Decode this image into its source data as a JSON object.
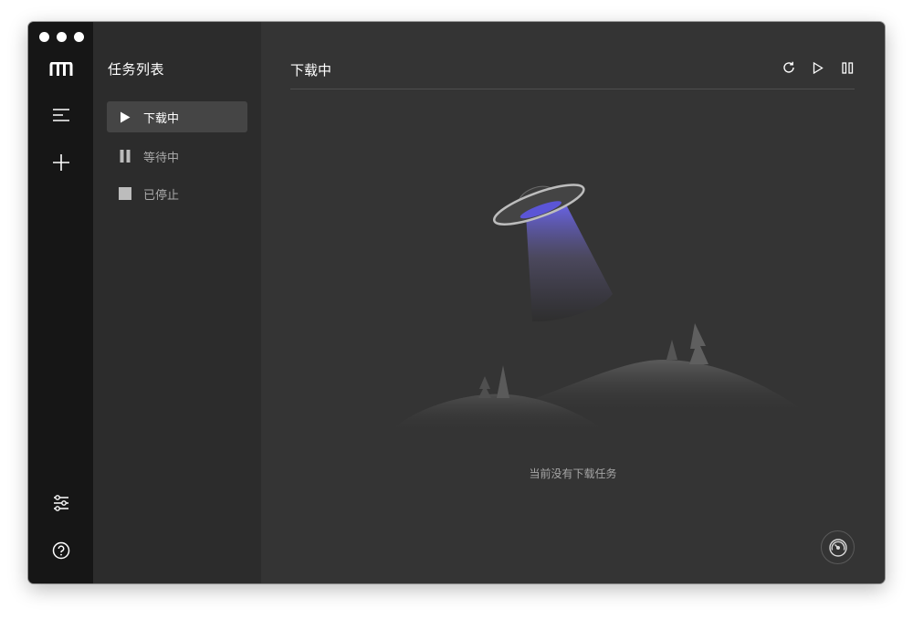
{
  "window": {
    "rail": {
      "logo_icon": "motrix-logo-icon",
      "items": [
        {
          "name": "task-list-icon"
        },
        {
          "name": "add-task-icon"
        },
        {
          "name": "preferences-icon"
        },
        {
          "name": "help-icon"
        }
      ]
    },
    "sidebar": {
      "title": "任务列表",
      "items": [
        {
          "label": "下载中",
          "icon": "play-icon",
          "active": true
        },
        {
          "label": "等待中",
          "icon": "pause-icon",
          "active": false
        },
        {
          "label": "已停止",
          "icon": "stop-icon",
          "active": false
        }
      ]
    },
    "main": {
      "title": "下载中",
      "toolbar": [
        {
          "icon": "refresh-icon"
        },
        {
          "icon": "resume-all-icon"
        },
        {
          "icon": "pause-all-icon"
        }
      ],
      "empty_text": "当前没有下载任务",
      "speed_icon": "speedometer-icon"
    }
  },
  "colors": {
    "rail_bg": "#161616",
    "sidebar_bg": "#2c2c2c",
    "main_bg": "#343434",
    "active_item_bg": "#454545",
    "ufo_beam": "#5b55d6"
  }
}
